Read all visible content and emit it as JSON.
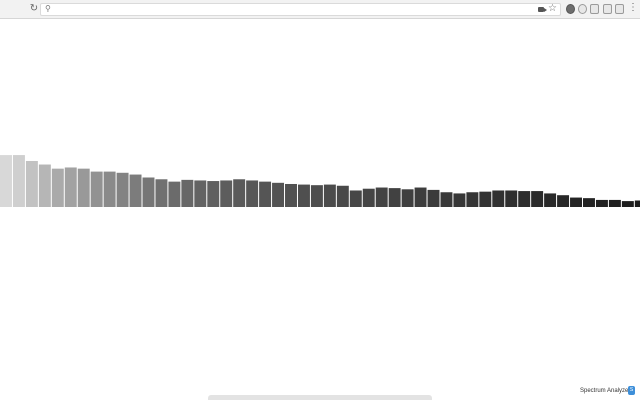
{
  "toolbar": {
    "icons": [
      "reload-icon",
      "search-icon",
      "camera-icon",
      "bookmark-star-icon",
      "menu-icon"
    ],
    "address_value": "",
    "reload_glyph": "↻",
    "search_glyph": "⚲",
    "star_glyph": "☆",
    "menu_glyph": "⋮",
    "extensions": [
      "extension-icon",
      "extension-icon",
      "extension-icon",
      "extension-icon",
      "extension-icon"
    ]
  },
  "status": {
    "label": "Spectrum Analyzer",
    "icon": "spectrum-analyzer-icon",
    "icon_glyph": "S",
    "icon_color": "#3d8fd9"
  },
  "chart_data": {
    "type": "bar",
    "bars": [
      {
        "value": 0.88,
        "color": "#d8d8d8"
      },
      {
        "value": 0.88,
        "color": "#cfcfcf"
      },
      {
        "value": 0.78,
        "color": "#c2c2c2"
      },
      {
        "value": 0.72,
        "color": "#b6b6b6"
      },
      {
        "value": 0.65,
        "color": "#aaaaaa"
      },
      {
        "value": 0.67,
        "color": "#a2a2a2"
      },
      {
        "value": 0.65,
        "color": "#999999"
      },
      {
        "value": 0.6,
        "color": "#929292"
      },
      {
        "value": 0.6,
        "color": "#8a8a8a"
      },
      {
        "value": 0.58,
        "color": "#838383"
      },
      {
        "value": 0.55,
        "color": "#7c7c7c"
      },
      {
        "value": 0.5,
        "color": "#767676"
      },
      {
        "value": 0.47,
        "color": "#707070"
      },
      {
        "value": 0.43,
        "color": "#6b6b6b"
      },
      {
        "value": 0.46,
        "color": "#676767"
      },
      {
        "value": 0.45,
        "color": "#636363"
      },
      {
        "value": 0.44,
        "color": "#606060"
      },
      {
        "value": 0.45,
        "color": "#5d5d5d"
      },
      {
        "value": 0.47,
        "color": "#5a5a5a"
      },
      {
        "value": 0.45,
        "color": "#575757"
      },
      {
        "value": 0.43,
        "color": "#555555"
      },
      {
        "value": 0.41,
        "color": "#535353"
      },
      {
        "value": 0.39,
        "color": "#515151"
      },
      {
        "value": 0.38,
        "color": "#4f4f4f"
      },
      {
        "value": 0.37,
        "color": "#4d4d4d"
      },
      {
        "value": 0.38,
        "color": "#4b4b4b"
      },
      {
        "value": 0.36,
        "color": "#494949"
      },
      {
        "value": 0.28,
        "color": "#474747"
      },
      {
        "value": 0.31,
        "color": "#454545"
      },
      {
        "value": 0.33,
        "color": "#434343"
      },
      {
        "value": 0.32,
        "color": "#414141"
      },
      {
        "value": 0.3,
        "color": "#3f3f3f"
      },
      {
        "value": 0.33,
        "color": "#3d3d3d"
      },
      {
        "value": 0.29,
        "color": "#3b3b3b"
      },
      {
        "value": 0.25,
        "color": "#393939"
      },
      {
        "value": 0.23,
        "color": "#373737"
      },
      {
        "value": 0.25,
        "color": "#353535"
      },
      {
        "value": 0.26,
        "color": "#333333"
      },
      {
        "value": 0.28,
        "color": "#313131"
      },
      {
        "value": 0.28,
        "color": "#2f2f2f"
      },
      {
        "value": 0.27,
        "color": "#2d2d2d"
      },
      {
        "value": 0.27,
        "color": "#2b2b2b"
      },
      {
        "value": 0.23,
        "color": "#292929"
      },
      {
        "value": 0.2,
        "color": "#272727"
      },
      {
        "value": 0.16,
        "color": "#252525"
      },
      {
        "value": 0.15,
        "color": "#232323"
      },
      {
        "value": 0.12,
        "color": "#212121"
      },
      {
        "value": 0.12,
        "color": "#1f1f1f"
      },
      {
        "value": 0.1,
        "color": "#1d1d1d"
      },
      {
        "value": 0.11,
        "color": "#1b1b1b"
      }
    ],
    "ylim": [
      0,
      1
    ],
    "grid": false,
    "legend": "none"
  }
}
